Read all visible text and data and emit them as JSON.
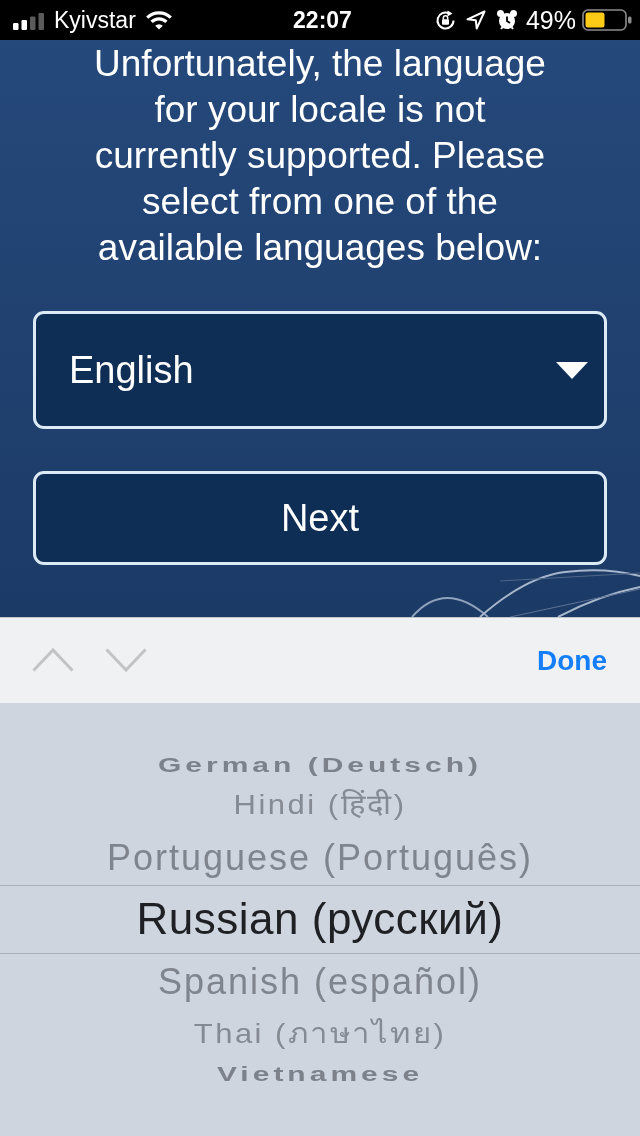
{
  "status_bar": {
    "carrier": "Kyivstar",
    "time": "22:07",
    "battery": "49%"
  },
  "message": "Unfortunately, the language for your locale is not currently supported. Please select from one of the available languages below:",
  "language_dropdown": {
    "value": "English"
  },
  "next_button": {
    "label": "Next"
  },
  "picker_toolbar": {
    "previous": {
      "disabled": true
    },
    "next": {
      "disabled": true
    },
    "done": "Done"
  },
  "picker": {
    "items": [
      {
        "label": "German (Deutsch)",
        "selected": false
      },
      {
        "label": "Hindi (हिंदी)",
        "selected": false
      },
      {
        "label": "Portuguese (Português)",
        "selected": false
      },
      {
        "label": "Russian (русский)",
        "selected": true
      },
      {
        "label": "Spanish (español)",
        "selected": false
      },
      {
        "label": "Thai (ภาษาไทย)",
        "selected": false
      },
      {
        "label": "Vietnamese",
        "selected": false
      }
    ]
  }
}
